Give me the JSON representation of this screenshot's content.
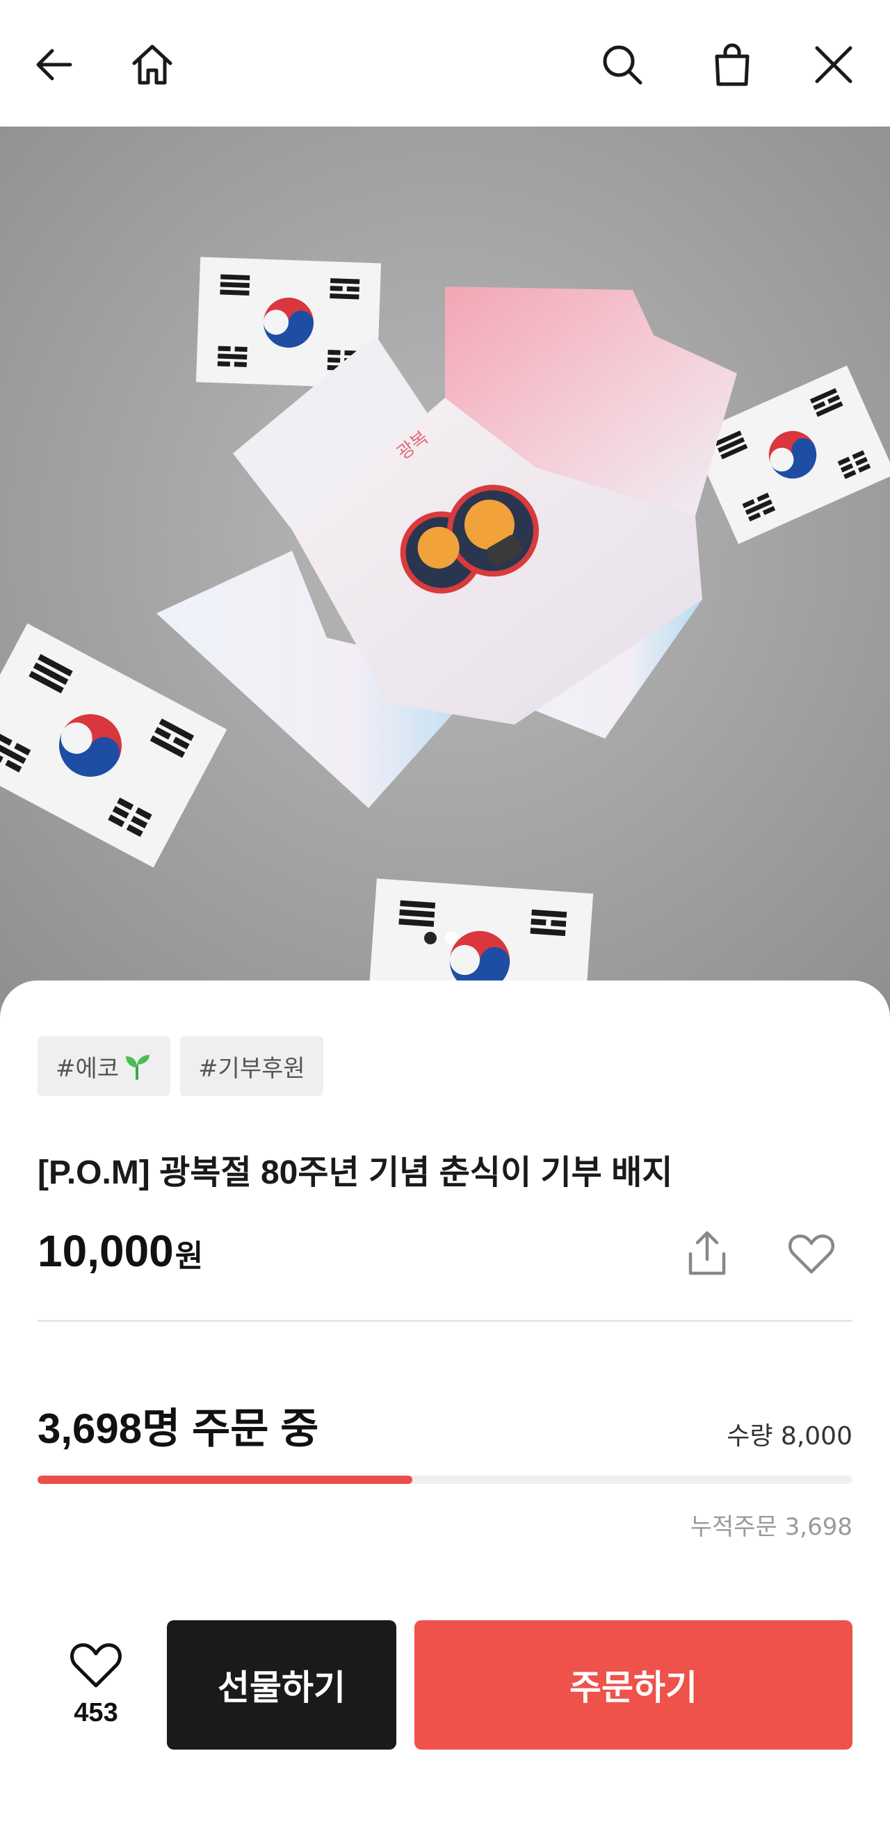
{
  "nav": {
    "icons": [
      "back-arrow-icon",
      "home-icon",
      "search-icon",
      "shopping-bag-icon",
      "close-icon"
    ]
  },
  "hero": {
    "image_pages": 2,
    "current_page": 2
  },
  "product": {
    "tags": [
      {
        "label": "#에코",
        "icon": "sprout-icon"
      },
      {
        "label": "#기부후원"
      }
    ],
    "title": "[P.O.M] 광복절 80주년 기념 춘식이 기부 배지",
    "price_value": "10,000",
    "price_unit": "원"
  },
  "funding": {
    "orders_label": "3,698명 주문 중",
    "quantity_label": "수량 8,000",
    "progress_fraction": 0.46,
    "cumulative_label": "누적주문 3,698"
  },
  "bottom": {
    "like_count": "453",
    "gift_label": "선물하기",
    "order_label": "주문하기"
  },
  "colors": {
    "accent": "#ef514b",
    "progress_fill": "#ea4f4a",
    "gift_button": "#1a1a1a"
  }
}
